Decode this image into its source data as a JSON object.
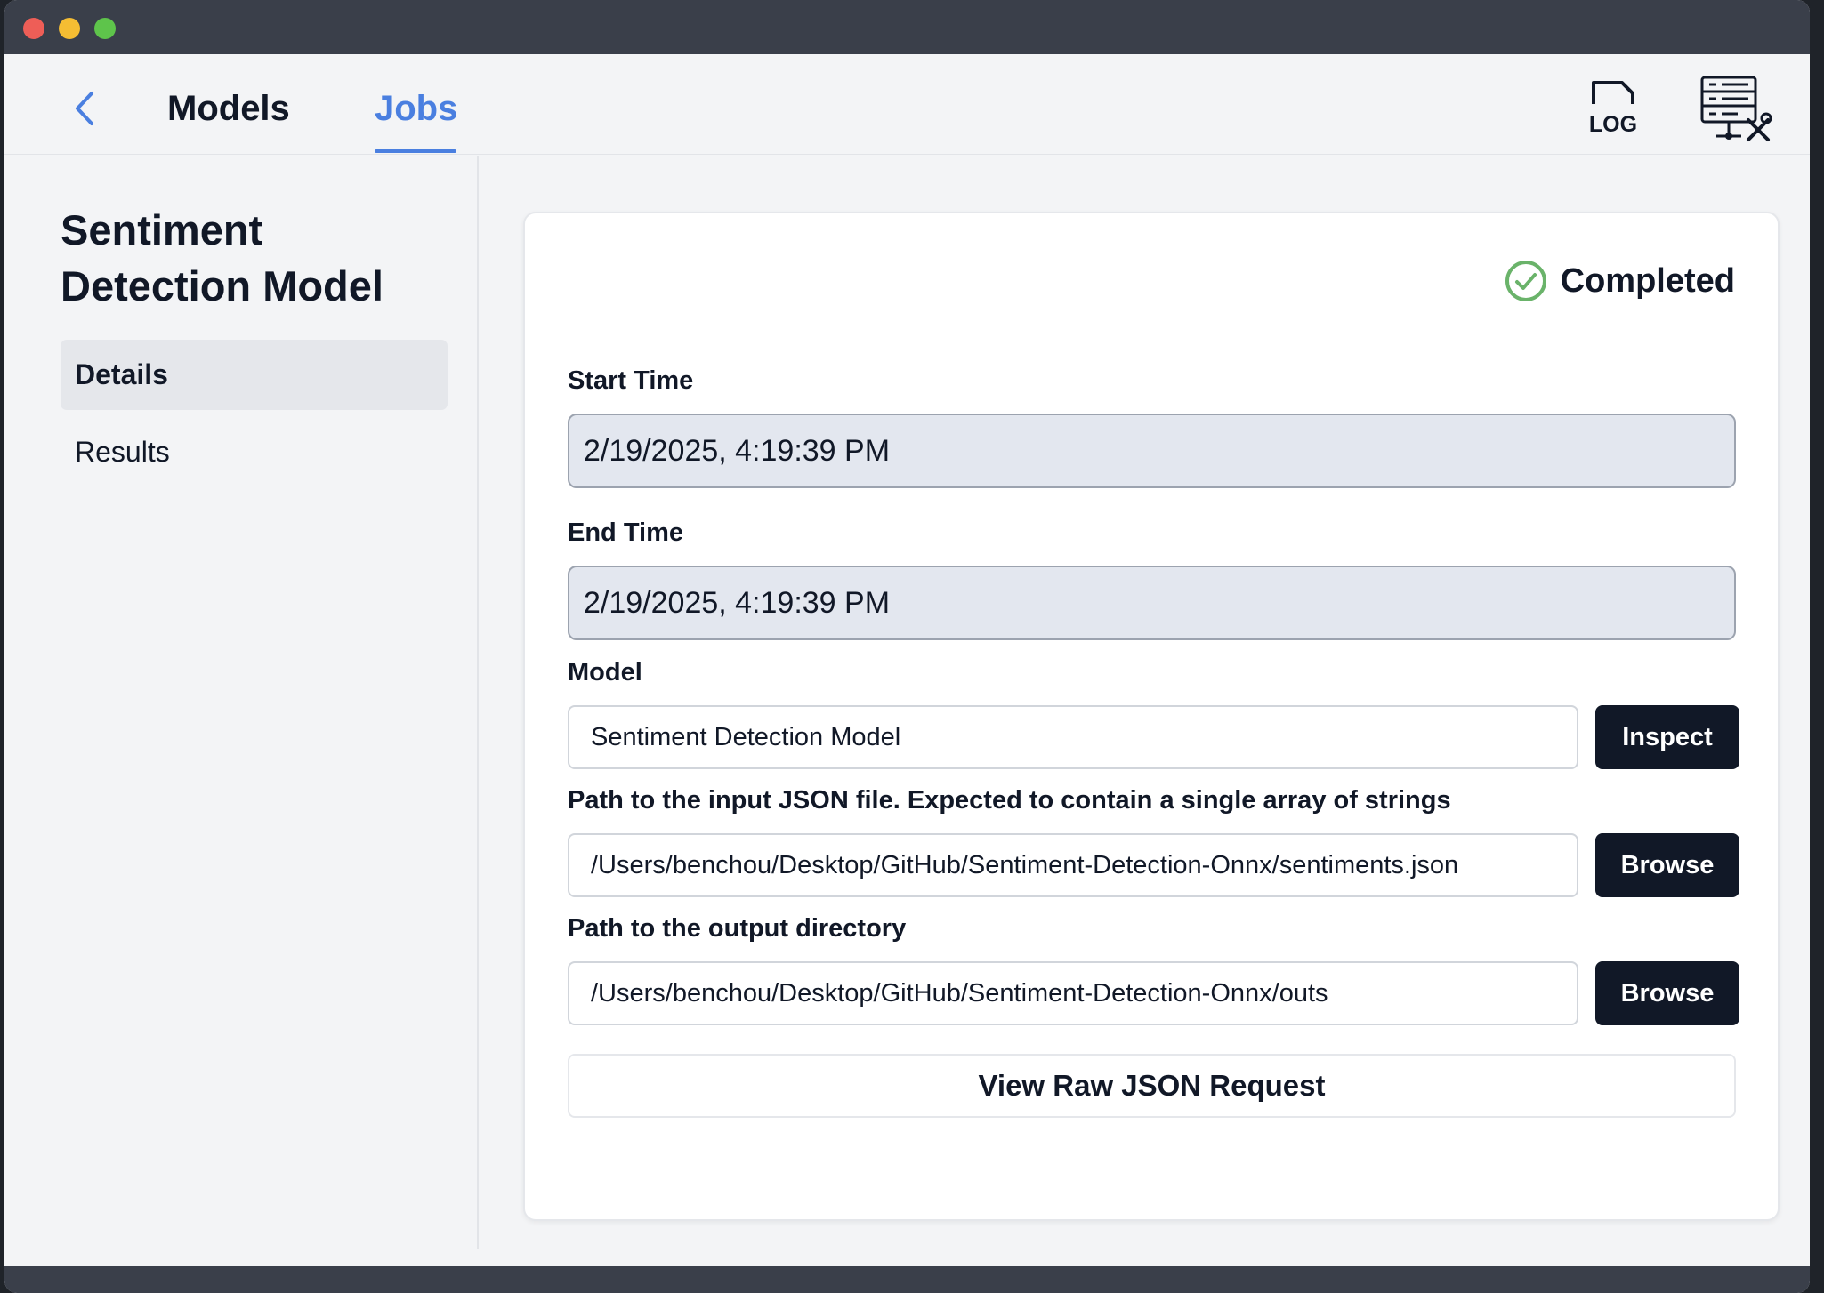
{
  "window": {
    "controls": [
      "close",
      "minimize",
      "maximize"
    ]
  },
  "nav": {
    "back_icon": "chevron-left-icon",
    "tabs": [
      {
        "label": "Models",
        "active": false
      },
      {
        "label": "Jobs",
        "active": true
      }
    ],
    "accent_color": "#4a7fe0",
    "right_icons": [
      "log-file-icon",
      "server-settings-icon"
    ],
    "log_icon_text": "LOG"
  },
  "sidebar": {
    "title": "Sentiment Detection Model",
    "items": [
      {
        "label": "Details",
        "active": true
      },
      {
        "label": "Results",
        "active": false
      }
    ]
  },
  "job": {
    "status": {
      "label": "Completed",
      "icon": "check-circle-icon",
      "color": "#6ab36a"
    },
    "start_time": {
      "label": "Start Time",
      "value": "2/19/2025, 4:19:39 PM"
    },
    "end_time": {
      "label": "End Time",
      "value": "2/19/2025, 4:19:39 PM"
    },
    "model": {
      "label": "Model",
      "value": "Sentiment Detection Model",
      "button_label": "Inspect"
    },
    "input_path": {
      "label": "Path to the input JSON file. Expected to contain a single array of strings",
      "value": "/Users/benchou/Desktop/GitHub/Sentiment-Detection-Onnx/sentiments.json",
      "button_label": "Browse"
    },
    "output_path": {
      "label": "Path to the output directory",
      "value": "/Users/benchou/Desktop/GitHub/Sentiment-Detection-Onnx/outs",
      "button_label": "Browse"
    },
    "raw_request_label": "View Raw JSON Request"
  }
}
